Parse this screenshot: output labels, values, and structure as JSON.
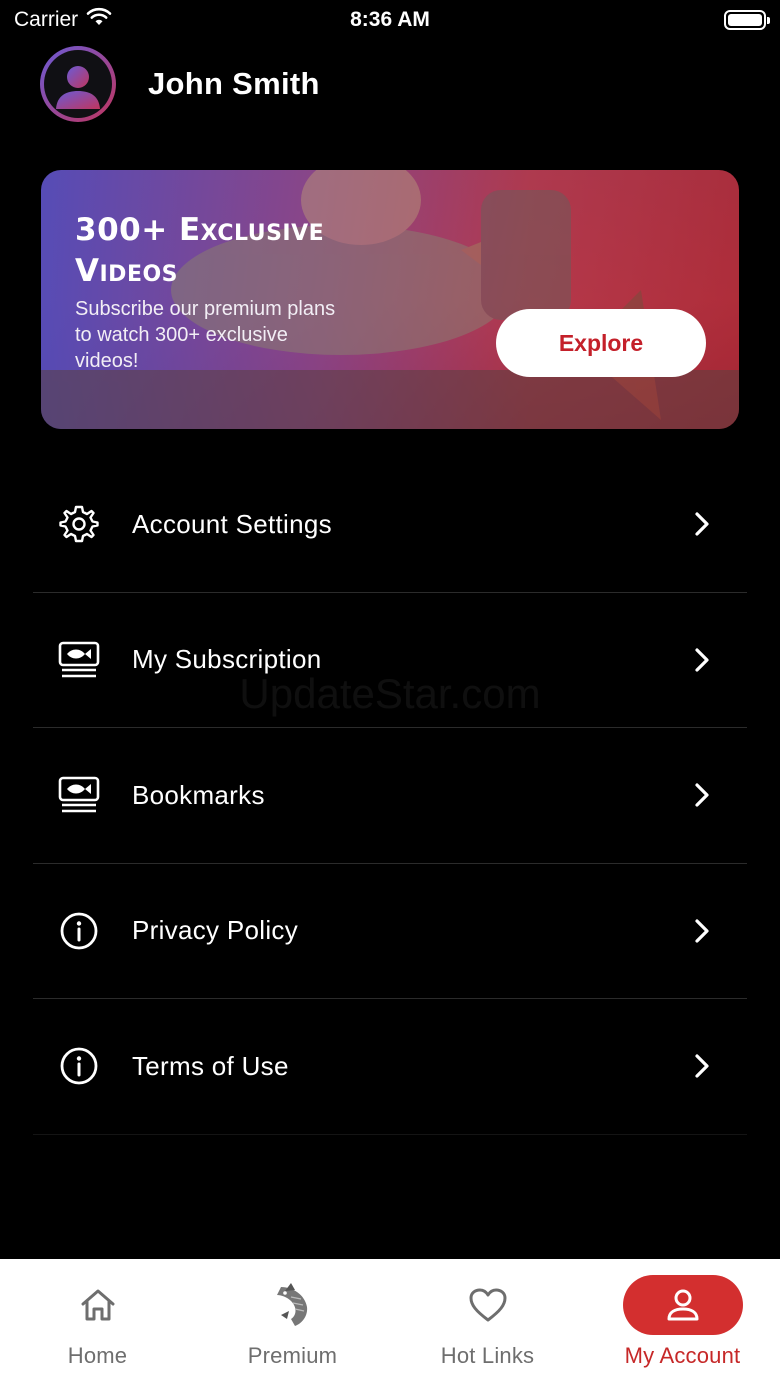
{
  "status_bar": {
    "carrier": "Carrier",
    "time": "8:36 AM"
  },
  "profile": {
    "name": "John Smith"
  },
  "banner": {
    "title_line1": "300+ Exclusive",
    "title_line2": "Videos",
    "subtitle": "Subscribe our premium plans to watch 300+ exclusive videos!",
    "button_label": "Explore"
  },
  "menu": {
    "items": [
      {
        "label": "Account Settings",
        "icon": "gear-icon"
      },
      {
        "label": "My Subscription",
        "icon": "video-card-icon"
      },
      {
        "label": "Bookmarks",
        "icon": "video-card-icon"
      },
      {
        "label": "Privacy Policy",
        "icon": "info-icon"
      },
      {
        "label": "Terms of Use",
        "icon": "info-icon"
      }
    ]
  },
  "watermark": "UpdateStar.com",
  "tabbar": {
    "tabs": [
      {
        "label": "Home",
        "icon": "home-icon",
        "active": false
      },
      {
        "label": "Premium",
        "icon": "fish-icon",
        "active": false
      },
      {
        "label": "Hot Links",
        "icon": "heart-icon",
        "active": false
      },
      {
        "label": "My Account",
        "icon": "person-icon",
        "active": true
      }
    ]
  },
  "colors": {
    "accent": "#d32f2f",
    "background": "#000000",
    "tabbar": "#ffffff"
  }
}
